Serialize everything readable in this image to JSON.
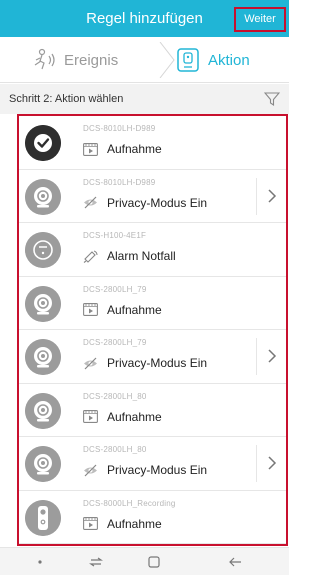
{
  "header": {
    "title": "Regel hinzufügen",
    "next_label": "Weiter"
  },
  "tabs": [
    {
      "label": "Ereignis",
      "icon": "motion-icon",
      "active": false
    },
    {
      "label": "Aktion",
      "icon": "device-icon",
      "active": true
    }
  ],
  "step": {
    "label": "Schritt 2: Aktion wählen",
    "filter_icon": "filter-icon"
  },
  "items": [
    {
      "model": "DCS-8010LH-D989",
      "action": "Aufnahme",
      "action_icon": "recording-icon",
      "device_icon": "checkmark-icon",
      "has_chevron": false
    },
    {
      "model": "DCS-8010LH-D989",
      "action": "Privacy-Modus Ein",
      "action_icon": "privacy-eye-icon",
      "device_icon": "camera-icon",
      "has_chevron": true
    },
    {
      "model": "DCS-H100-4E1F",
      "action": "Alarm Notfall",
      "action_icon": "alarm-icon",
      "device_icon": "siren-device-icon",
      "has_chevron": false
    },
    {
      "model": "DCS-2800LH_79",
      "action": "Aufnahme",
      "action_icon": "recording-icon",
      "device_icon": "camera-icon",
      "has_chevron": false
    },
    {
      "model": "DCS-2800LH_79",
      "action": "Privacy-Modus Ein",
      "action_icon": "privacy-eye-icon",
      "device_icon": "camera-icon",
      "has_chevron": true
    },
    {
      "model": "DCS-2800LH_80",
      "action": "Aufnahme",
      "action_icon": "recording-icon",
      "device_icon": "camera-icon",
      "has_chevron": false
    },
    {
      "model": "DCS-2800LH_80",
      "action": "Privacy-Modus Ein",
      "action_icon": "privacy-eye-icon",
      "device_icon": "camera-icon",
      "has_chevron": true
    },
    {
      "model": "DCS-8000LH_Recording",
      "action": "Aufnahme",
      "action_icon": "recording-icon",
      "device_icon": "doorbell-camera-icon",
      "has_chevron": false
    }
  ],
  "colors": {
    "accent": "#20b5d6",
    "highlight_border": "#c8102e"
  }
}
